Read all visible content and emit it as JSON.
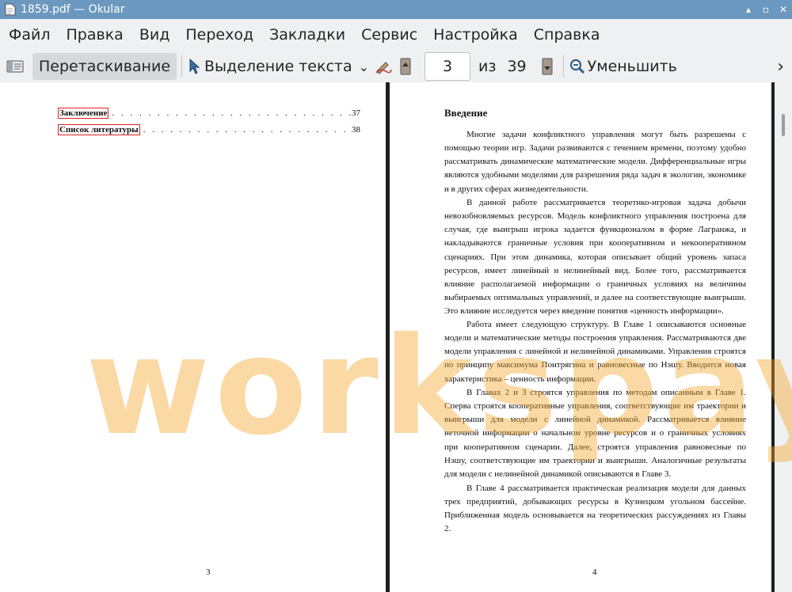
{
  "window": {
    "title": "1859.pdf  — Okular",
    "minimize_glyph": "▴",
    "maximize_glyph": "▫",
    "close_glyph": "✕"
  },
  "menu": {
    "items": [
      "Файл",
      "Правка",
      "Вид",
      "Переход",
      "Закладки",
      "Сервис",
      "Настройка",
      "Справка"
    ]
  },
  "toolbar": {
    "drag_label": "Перетаскивание",
    "select_text_label": "Выделение текста",
    "dropdown_glyph": "⌄",
    "page_value": "3",
    "of_label": "из",
    "total_pages": "39",
    "zoom_out_label": "Уменьшить",
    "more_glyph": "›"
  },
  "left_page": {
    "toc": [
      {
        "title": "Заключение",
        "dots": ". . . . . . . . . . . . . . . . . . . . . . . . . . . . . . . . . . . . . . . . . . . . . . . . . .",
        "page": "37"
      },
      {
        "title": "Список литературы",
        "dots": ". . . . . . . . . . . . . . . . . . . . . . . . . . . . . . . . . . . . . . . . . . . . . . . . . .",
        "page": "38"
      }
    ],
    "page_number": "3"
  },
  "right_page": {
    "heading": "Введение",
    "paragraphs": [
      "Многие задачи конфликтного управления могут быть разрешены с помощью теории игр. Задачи развиваются с течением времени, поэтому удобно рассматривать динамические математические модели. Дифференциальные игры являются удобными моделями для разрешения ряда задач в экологии, экономике и в других сферах жизнедеятельности.",
      "В данной работе рассматривается теоретико-игровая задача добычи невозобновляемых ресурсов. Модель конфликтного управления построена для случая, где выигрыш игрока задается функционалом в форме Лагранжа, и накладываются граничные условия при кооперативном и некооперативном сценариях. При этом динамика, которая описывает общий уровень запаса ресурсов, имеет линейный и нелинейный вид. Более того, рассматривается влияние располагаемой информации о граничных условиях на величины выбираемых оптимальных управлений, и далее на соответствующие выигрыши. Это влияние исследуется через введение понятия «ценность информации».",
      "Работа имеет следующую структуру. В Главе 1 описываются основные модели и математические методы построения управления. Рассматриваются две модели управления с линейной и нелинейной динамиками. Управления строятся по принципу максимума Понтрягина и равновесные по Нэшу. Вводится новая характеристика – ценность информации.",
      "В Главах 2 и 3 строятся управления по методам описанным в Главе 1. Сперва строятся кооперативные управления, соответствующие им траектории и выигрыши для модели с линейной динамикой. Рассматривается влияние неточной информации о начальном уровне ресурсов и о граничных условиях при кооперативном сценарии. Далее, строятся управления равновесные по Нэшу, соответствующие им траектории и выигрыши. Аналогичные результаты для модели с нелинейной динамикой описываются в Главе 3.",
      "В Главе 4 рассматривается практическая реализация модели для данных трех предприятий, добывающих ресурсы в Кузнецком угольном бассейне. Приближенная модель основывается на теоретических рассуждениях из Главы 2."
    ],
    "page_number": "4"
  },
  "watermark": "workspay.ru",
  "colors": {
    "titlebar": "#6b98be",
    "chrome": "#eff0f1",
    "watermark": "#f4a52b",
    "toc_box": "#e02020"
  }
}
